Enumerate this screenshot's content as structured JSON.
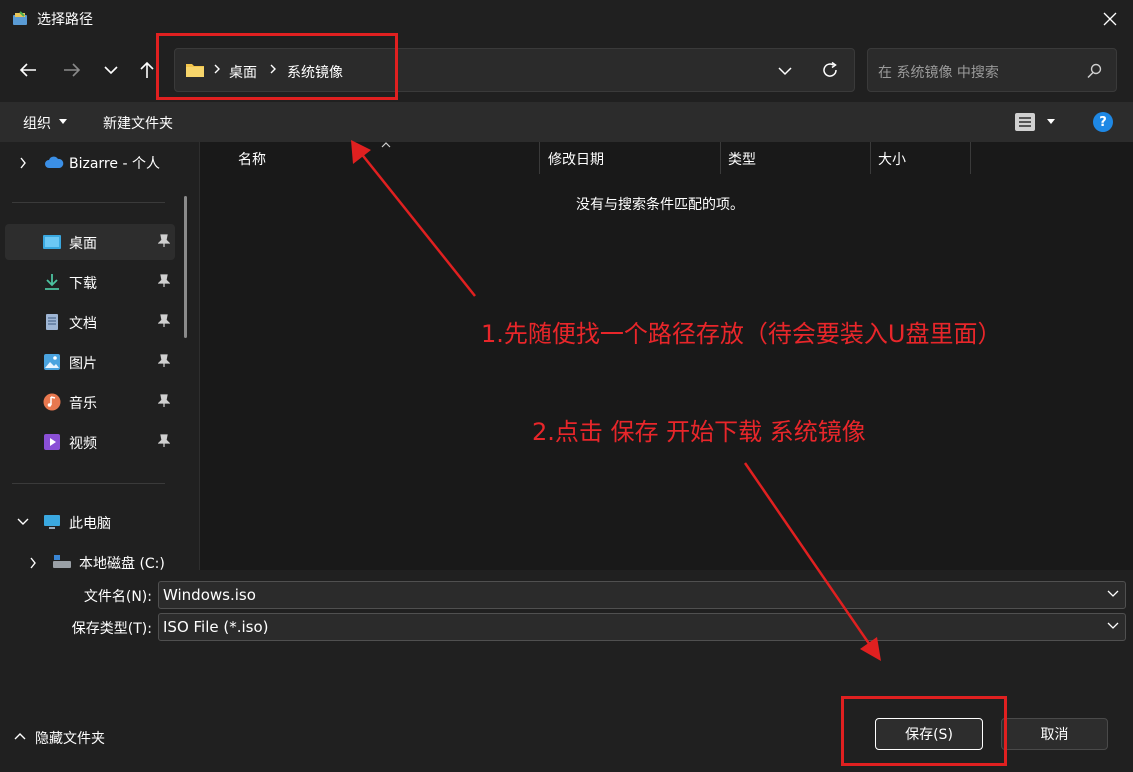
{
  "window": {
    "title": "选择路径"
  },
  "address": {
    "segments": [
      "桌面",
      "系统镜像"
    ]
  },
  "search": {
    "placeholder": "在 系统镜像 中搜索"
  },
  "toolbar": {
    "organize": "组织",
    "new_folder": "新建文件夹",
    "help": "?"
  },
  "sidebar": {
    "onedrive": "Bizarre - 个人",
    "quick": [
      {
        "label": "桌面",
        "icon": "desktop-icon"
      },
      {
        "label": "下载",
        "icon": "download-icon"
      },
      {
        "label": "文档",
        "icon": "document-icon"
      },
      {
        "label": "图片",
        "icon": "picture-icon"
      },
      {
        "label": "音乐",
        "icon": "music-icon"
      },
      {
        "label": "视频",
        "icon": "video-icon"
      }
    ],
    "this_pc": "此电脑",
    "local_disk": "本地磁盘 (C:)"
  },
  "columns": [
    "名称",
    "修改日期",
    "类型",
    "大小"
  ],
  "empty_message": "没有与搜索条件匹配的项。",
  "fields": {
    "filename_label": "文件名(N):",
    "filename_value": "Windows.iso",
    "type_label": "保存类型(T):",
    "type_value": "ISO File (*.iso)"
  },
  "footer": {
    "hide_folders": "隐藏文件夹",
    "save": "保存(S)",
    "cancel": "取消"
  },
  "annotations": {
    "step1": "1.先随便找一个路径存放（待会要装入U盘里面）",
    "step2": "2.点击 保存 开始下载 系统镜像",
    "color": "#e8262a"
  }
}
